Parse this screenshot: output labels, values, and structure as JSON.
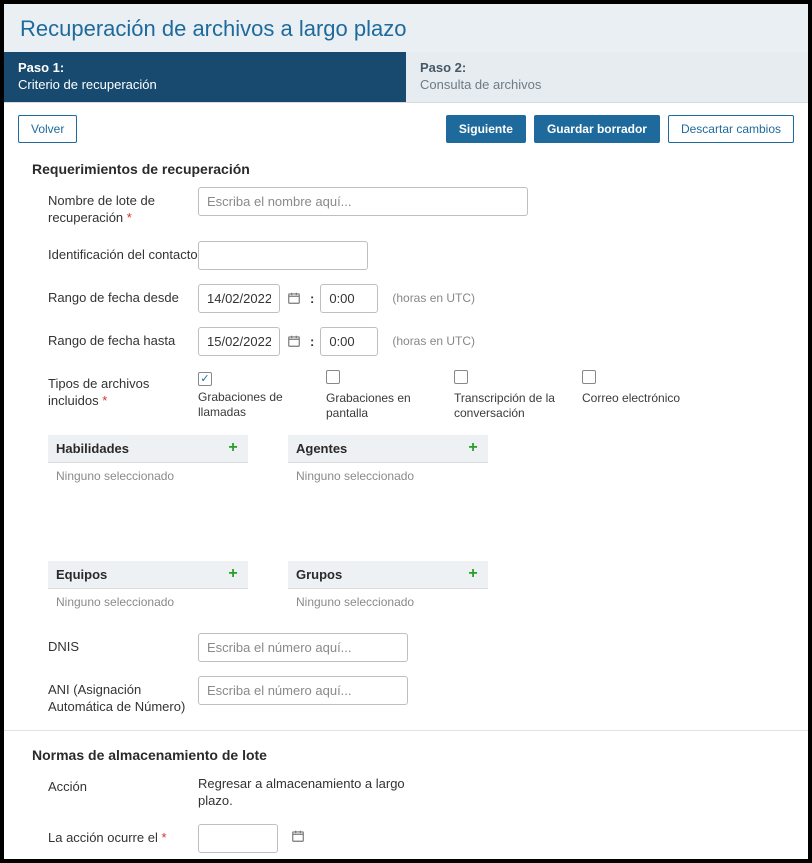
{
  "header": {
    "title": "Recuperación de archivos a largo plazo"
  },
  "steps": {
    "step1": {
      "title": "Paso 1:",
      "sub": "Criterio de recuperación"
    },
    "step2": {
      "title": "Paso 2:",
      "sub": "Consulta de archivos"
    }
  },
  "buttons": {
    "back": "Volver",
    "next": "Siguiente",
    "save_draft": "Guardar borrador",
    "discard": "Descartar cambios"
  },
  "section1": {
    "title": "Requerimientos de recuperación",
    "batch_name": {
      "label": "Nombre de lote de recuperación",
      "placeholder": "Escriba el nombre aquí..."
    },
    "contact_id": {
      "label": "Identificación del contacto"
    },
    "date_from": {
      "label": "Rango de fecha desde",
      "date": "14/02/2022",
      "time": "0:00",
      "utc": "(horas en UTC)"
    },
    "date_to": {
      "label": "Rango de fecha hasta",
      "date": "15/02/2022",
      "time": "0:00",
      "utc": "(horas en UTC)"
    },
    "file_types": {
      "label": "Tipos de archivos incluidos",
      "items": [
        {
          "label": "Grabaciones de llamadas",
          "checked": true
        },
        {
          "label": "Grabaciones en pantalla",
          "checked": false
        },
        {
          "label": "Transcripción de la conversación",
          "checked": false
        },
        {
          "label": "Correo electrónico",
          "checked": false
        }
      ]
    },
    "pickers": {
      "skills": {
        "title": "Habilidades",
        "empty": "Ninguno seleccionado"
      },
      "agents": {
        "title": "Agentes",
        "empty": "Ninguno seleccionado"
      },
      "teams": {
        "title": "Equipos",
        "empty": "Ninguno seleccionado"
      },
      "groups": {
        "title": "Grupos",
        "empty": "Ninguno seleccionado"
      }
    },
    "dnis": {
      "label": "DNIS",
      "placeholder": "Escriba el número aquí..."
    },
    "ani": {
      "label": "ANI (Asignación Automática de Número)",
      "placeholder": "Escriba el número aquí..."
    }
  },
  "section2": {
    "title": "Normas de almacenamiento de lote",
    "action": {
      "label": "Acción",
      "value": "Regresar a almacenamiento a largo plazo."
    },
    "action_date": {
      "label": "La acción ocurre el"
    }
  },
  "glyphs": {
    "colon": ":"
  }
}
